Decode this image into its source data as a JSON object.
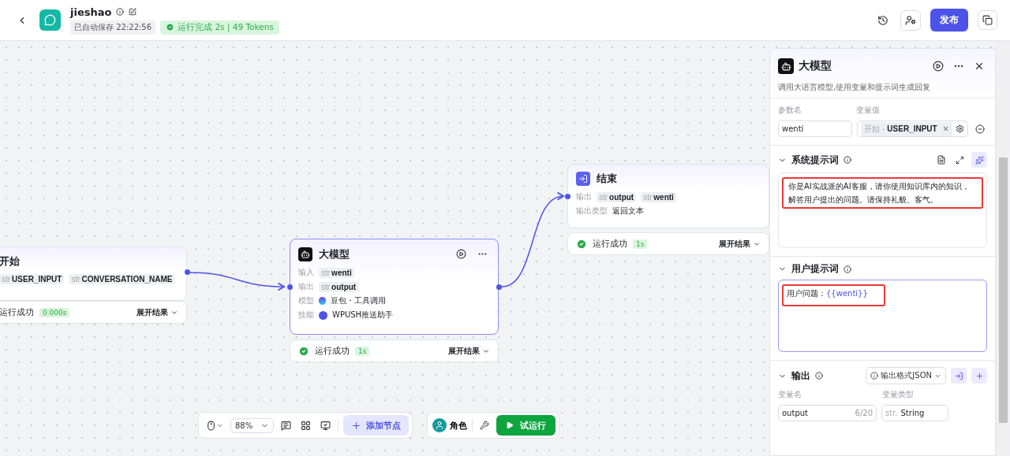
{
  "header": {
    "title": "jieshao",
    "save_status": "已自动保存 22:22:56",
    "run_status": "运行完成 2s | 49 Tokens",
    "publish": "发布"
  },
  "nodes": [
    {
      "kind": "start",
      "title": "开始",
      "rows": [
        {
          "kind": "tags",
          "label": "",
          "tags": [
            {
              "type": "str",
              "name": "USER_INPUT"
            },
            {
              "type": "str",
              "name": "CONVERSATION_NAME"
            }
          ]
        }
      ],
      "result": {
        "status": "运行成功",
        "time": "0.000s",
        "expand": "展开结果",
        "icon": false
      }
    },
    {
      "kind": "llm",
      "title": "大模型",
      "rows": [
        {
          "kind": "tags",
          "label": "输入",
          "tags": [
            {
              "type": "str",
              "name": "wenti"
            }
          ]
        },
        {
          "kind": "tags",
          "label": "输出",
          "tags": [
            {
              "type": "str",
              "name": "output"
            }
          ]
        },
        {
          "kind": "model",
          "label": "模型",
          "value": "豆包・工具调用"
        },
        {
          "kind": "skill",
          "label": "技能",
          "value": "WPUSH推送助手"
        }
      ],
      "result": {
        "status": "运行成功",
        "time": "1s",
        "expand": "展开结果",
        "icon": true
      }
    },
    {
      "kind": "end",
      "title": "结束",
      "rows": [
        {
          "kind": "tags",
          "label": "输出",
          "tags": [
            {
              "type": "str",
              "name": "output"
            },
            {
              "type": "str",
              "name": "wenti"
            }
          ]
        },
        {
          "kind": "text",
          "label": "输出类型",
          "value": "返回文本"
        }
      ],
      "result": {
        "status": "运行成功",
        "time": "1s",
        "expand": "展开结果",
        "icon": true
      }
    }
  ],
  "panel": {
    "title": "大模型",
    "description": "调用大语言模型,使用变量和提示词生成回复",
    "params": {
      "name_label": "参数名",
      "value_label": "变量值",
      "rows": [
        {
          "name": "wenti",
          "source": "开始 -",
          "variable": "USER_INPUT"
        }
      ]
    },
    "system_prompt": {
      "title": "系统提示词",
      "text": "你是AI实战派的AI客服，请你使用知识库内的知识，解答用户提出的问题。请保持礼貌、客气。",
      "expanded": true
    },
    "user_prompt": {
      "title": "用户提示词",
      "prefix": "用户问题：",
      "variable": "{{wenti}}",
      "expanded": true
    },
    "output": {
      "title": "输出",
      "format": "输出格式JSON",
      "name_label": "变量名",
      "type_label": "变量类型",
      "rows": [
        {
          "name": "output",
          "count": "6/20",
          "type_prefix": "str.",
          "type": "String"
        }
      ],
      "expanded": true
    }
  },
  "toolbar": {
    "zoom": "88%",
    "add_node": "添加节点",
    "role": "角色",
    "run": "试运行"
  }
}
